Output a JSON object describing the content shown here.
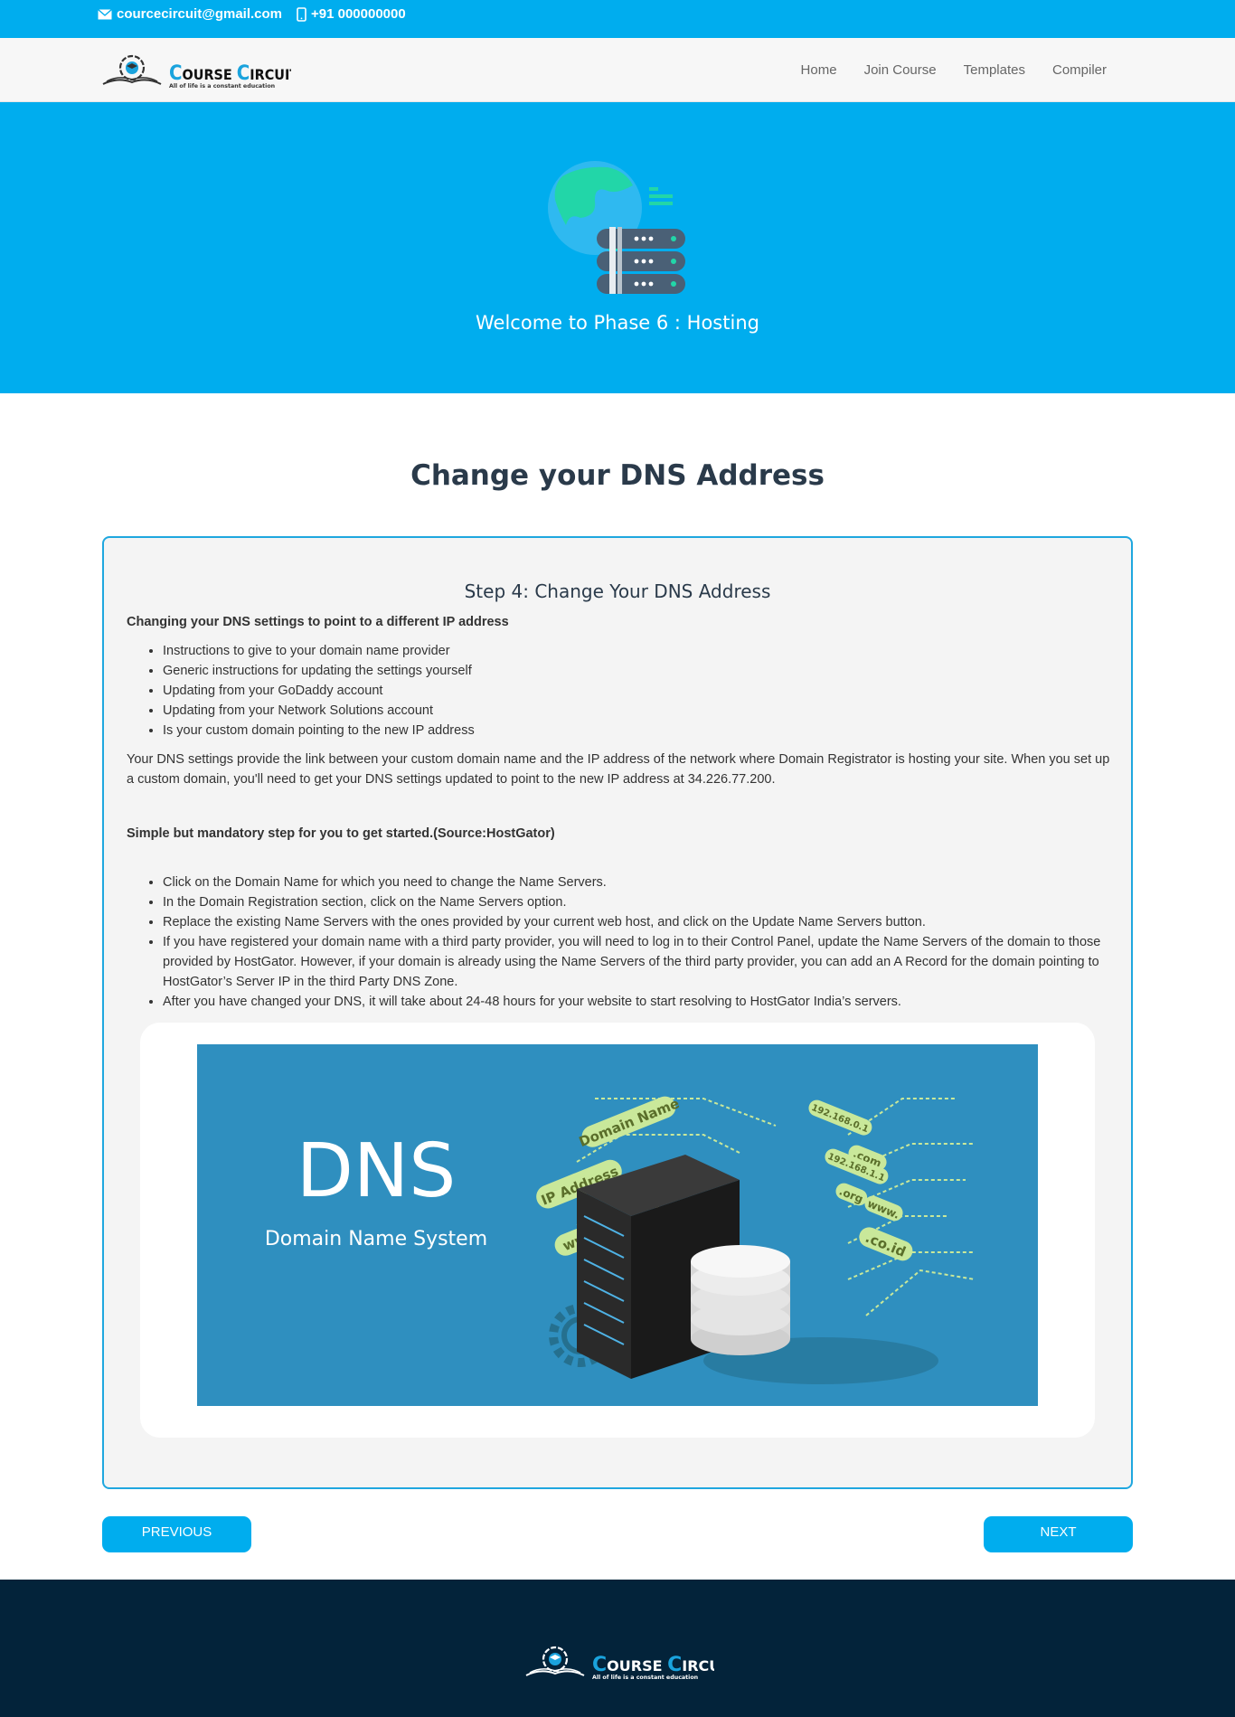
{
  "topbar": {
    "email": "courcecircuit@gmail.com",
    "phone": "+91 000000000"
  },
  "brand": {
    "name_first": "Course",
    "name_second": "Circuit",
    "tagline": "All of life is a constant education"
  },
  "nav": {
    "items": [
      {
        "label": "Home"
      },
      {
        "label": "Join Course"
      },
      {
        "label": "Templates"
      },
      {
        "label": "Compiler"
      }
    ]
  },
  "hero": {
    "title": "Welcome to Phase 6 : Hosting",
    "icon": "globe-server-icon"
  },
  "page": {
    "title": "Change your DNS Address"
  },
  "card": {
    "step_title": "Step 4: Change Your DNS Address",
    "subheading": "Changing your DNS settings to point to a different IP address",
    "list1": [
      "Instructions to give to your domain name provider",
      "Generic instructions for updating the settings yourself",
      "Updating from your GoDaddy account",
      "Updating from your Network Solutions account",
      "Is your custom domain pointing to the new IP address"
    ],
    "description": "Your DNS settings provide the link between your custom domain name and the IP address of the network where Domain Registrator is hosting your site. When you set up a custom domain, you'll need to get your DNS settings updated to point to the new IP address at 34.226.77.200.",
    "subheading2": "Simple but mandatory step for you to get started.(Source:HostGator)",
    "list2": [
      "Click on the Domain Name for which you need to change the Name Servers.",
      "In the Domain Registration section, click on the Name Servers option.",
      "Replace the existing Name Servers with the ones provided by your current web host, and click on the Update Name Servers button.",
      "If you have registered your domain name with a third party provider, you will need to log in to their Control Panel, update the Name Servers of the domain to those provided by HostGator. However, if your domain is already using the Name Servers of the third party provider, you can add an A Record for the domain pointing to HostGator’s Server IP in the third Party DNS Zone.",
      "After you have changed your DNS, it will take about 24-48 hours for your website to start resolving to HostGator India’s servers."
    ]
  },
  "dns_image": {
    "big": "DNS",
    "small": "Domain Name System",
    "tags": [
      "Domain Name",
      "IP Address",
      "www.",
      "192.168.0.1",
      ".com",
      "192.168.1.1",
      ".org",
      "www.",
      ".co.id"
    ]
  },
  "buttons": {
    "previous": "PREVIOUS",
    "next": "NEXT"
  },
  "colors": {
    "primary": "#00ADEE",
    "footer": "#03233a",
    "card_border": "#1fa7df",
    "image_bg": "#2f8fbf"
  }
}
